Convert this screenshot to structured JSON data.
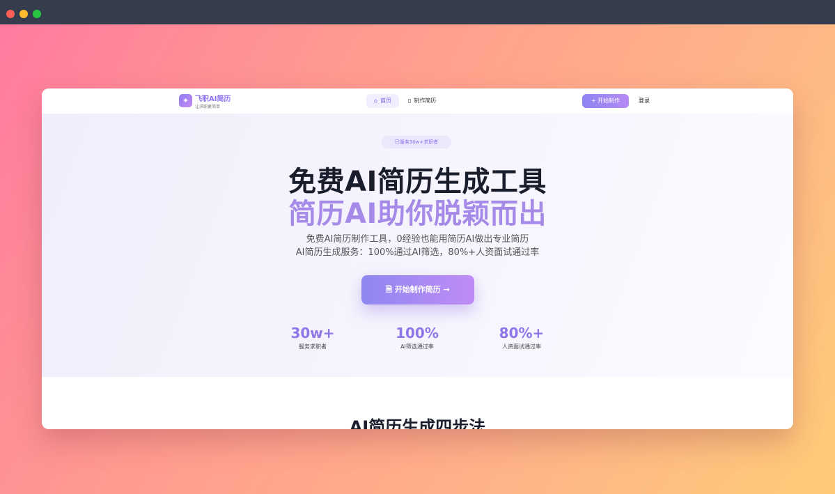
{
  "browser": {
    "controls": [
      "close",
      "minimize",
      "maximize"
    ]
  },
  "nav": {
    "brand_name": "飞职AI简历",
    "brand_slogan": "让求职更简单",
    "links": [
      {
        "label": "首页",
        "icon": "home-icon",
        "active": true
      },
      {
        "label": "制作简历",
        "icon": "document-icon",
        "active": false
      }
    ],
    "start_button": "开始制作",
    "login": "登录"
  },
  "hero": {
    "badge": "已服务30w+求职者",
    "title_line1": "免费AI简历生成工具",
    "title_line2": "简历AI助你脱颖而出",
    "subtitle_line1": "免费AI简历制作工具，0经验也能用简历AI做出专业简历",
    "subtitle_line2": "AI简历生成服务：100%通过AI筛选，80%+人资面试通过率",
    "cta": "开始制作简历",
    "stats": [
      {
        "value": "30w+",
        "label": "服务求职者"
      },
      {
        "value": "100%",
        "label": "AI筛选通过率"
      },
      {
        "value": "80%+",
        "label": "人资面试通过率"
      }
    ]
  },
  "section": {
    "title": "AI简历生成四步法"
  },
  "colors": {
    "accent": "#8b6ff0",
    "accent_light": "#a58ae8",
    "heading": "#1a1d2b"
  }
}
